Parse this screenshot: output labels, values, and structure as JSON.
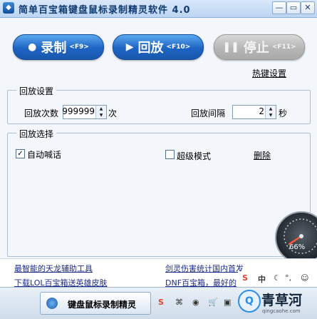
{
  "window": {
    "title": "简单百宝箱键盘鼠标录制精灵软件 4.0",
    "controls": {
      "minimize": "—",
      "restore": "▭",
      "close": "✕"
    }
  },
  "buttons": {
    "record": {
      "label": "录制",
      "key": "<F9>",
      "icon": "circle-icon"
    },
    "replay": {
      "label": "回放",
      "key": "<F10>",
      "icon": "play-icon"
    },
    "stop": {
      "label": "停止",
      "key": "<F11>",
      "icon": "pause-icon",
      "enabled": false
    }
  },
  "hotkey_link": "热键设置",
  "replay_settings": {
    "group_label": "回放设置",
    "count_label": "回放次数",
    "count_value": "999999",
    "count_unit": "次",
    "interval_label": "回放间隔",
    "interval_value": "2",
    "interval_unit": "秒"
  },
  "replay_select": {
    "group_label": "回放选择",
    "auto_shout": {
      "label": "自动喊话",
      "checked": true
    },
    "super_mode": {
      "label": "超级模式",
      "checked": false
    },
    "delete_link": "删除"
  },
  "gauge": {
    "percent": "66%"
  },
  "ads": [
    "最智能的天龙辅助工具",
    "剑灵伤害统计国内首发",
    "下载LOL百宝箱送英雄皮肤",
    "DNF百宝箱，最好的"
  ],
  "taskbar": {
    "task_label": "键盘鼠标录制精灵",
    "tray_s": "S",
    "tray_zh": "中",
    "brand_name": "青草河",
    "brand_url": "qingcaohe.com",
    "brand_logo": "Q"
  },
  "colors": {
    "accent": "#1d64c3",
    "title_text": "#123b70"
  }
}
